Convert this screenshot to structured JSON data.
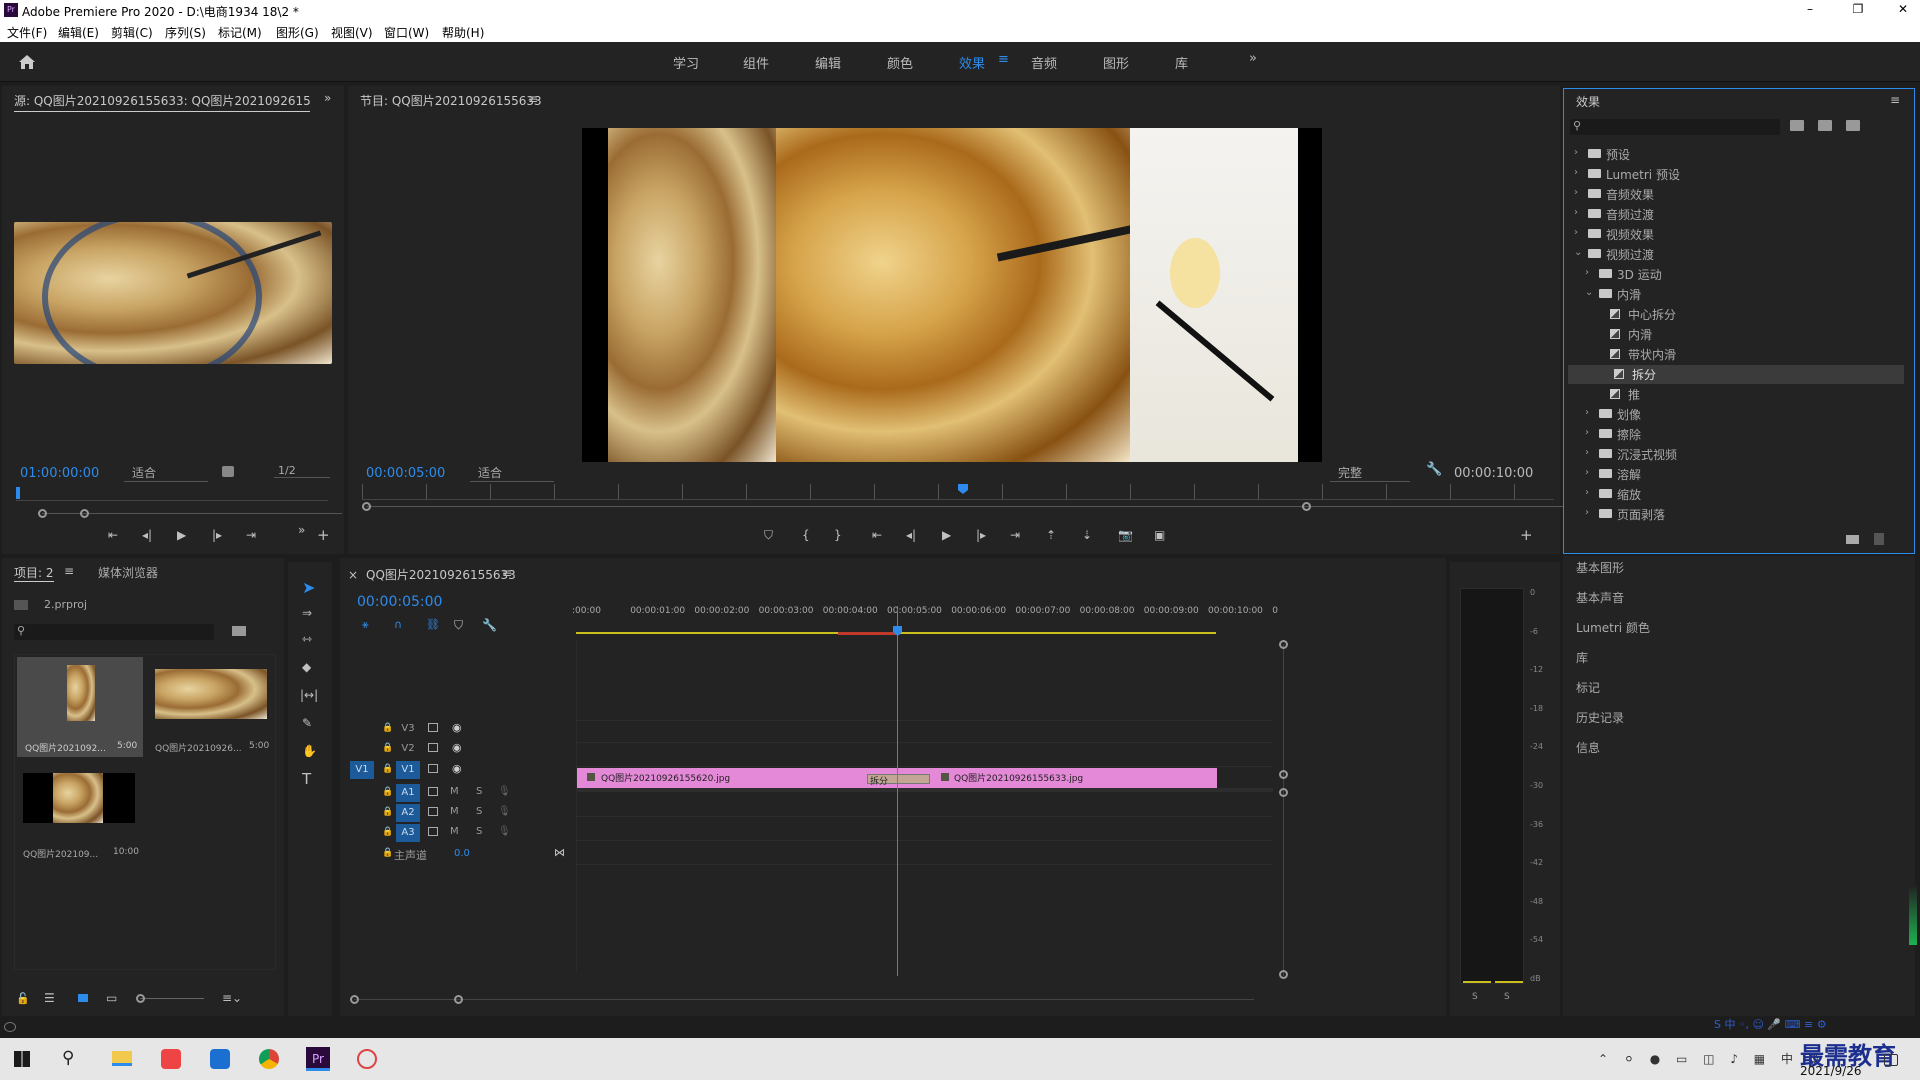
{
  "titlebar": {
    "title": "Adobe Premiere Pro 2020 - D:\\电商1934 18\\2 *",
    "min": "–",
    "max": "❐",
    "close": "✕"
  },
  "menus": [
    "文件(F)",
    "编辑(E)",
    "剪辑(C)",
    "序列(S)",
    "标记(M)",
    "图形(G)",
    "视图(V)",
    "窗口(W)",
    "帮助(H)"
  ],
  "workspaces": [
    "学习",
    "组件",
    "编辑",
    "颜色",
    "效果",
    "音频",
    "图形",
    "库"
  ],
  "workspace_active": "效果",
  "source": {
    "tab": "源: QQ图片20210926155633: QQ图片20210926155633.",
    "timecode": "01:00:00:00",
    "fit": "适合",
    "ratio": "1/2"
  },
  "program": {
    "tab": "节目: QQ图片20210926155633",
    "timecode": "00:00:05:00",
    "fit": "适合",
    "quality": "完整",
    "duration": "00:00:10:00"
  },
  "effects": {
    "title": "效果",
    "items": [
      {
        "label": "预设",
        "level": 0,
        "type": "folder-star",
        "state": "closed"
      },
      {
        "label": "Lumetri 预设",
        "level": 0,
        "type": "folder-star",
        "state": "closed"
      },
      {
        "label": "音频效果",
        "level": 0,
        "type": "folder",
        "state": "closed"
      },
      {
        "label": "音频过渡",
        "level": 0,
        "type": "folder",
        "state": "closed"
      },
      {
        "label": "视频效果",
        "level": 0,
        "type": "folder",
        "state": "closed"
      },
      {
        "label": "视频过渡",
        "level": 0,
        "type": "folder",
        "state": "open"
      },
      {
        "label": "3D 运动",
        "level": 1,
        "type": "folder",
        "state": "closed"
      },
      {
        "label": "内滑",
        "level": 1,
        "type": "folder",
        "state": "open"
      },
      {
        "label": "中心拆分",
        "level": 2,
        "type": "fx",
        "state": ""
      },
      {
        "label": "内滑",
        "level": 2,
        "type": "fx",
        "state": ""
      },
      {
        "label": "带状内滑",
        "level": 2,
        "type": "fx",
        "state": ""
      },
      {
        "label": "拆分",
        "level": 2,
        "type": "fx",
        "state": "selected"
      },
      {
        "label": "推",
        "level": 2,
        "type": "fx",
        "state": ""
      },
      {
        "label": "划像",
        "level": 1,
        "type": "folder",
        "state": "closed"
      },
      {
        "label": "擦除",
        "level": 1,
        "type": "folder",
        "state": "closed"
      },
      {
        "label": "沉浸式视频",
        "level": 1,
        "type": "folder",
        "state": "closed"
      },
      {
        "label": "溶解",
        "level": 1,
        "type": "folder",
        "state": "closed"
      },
      {
        "label": "缩放",
        "level": 1,
        "type": "folder",
        "state": "closed"
      },
      {
        "label": "页面剥落",
        "level": 1,
        "type": "folder",
        "state": "closed"
      }
    ]
  },
  "side_panels": [
    "基本图形",
    "基本声音",
    "Lumetri 颜色",
    "库",
    "标记",
    "历史记录",
    "信息"
  ],
  "project": {
    "tab": "项目: 2",
    "tab2": "媒体浏览器",
    "file": "2.prproj",
    "clips": [
      {
        "name": "QQ图片2021092...",
        "dur": "5:00"
      },
      {
        "name": "QQ图片20210926...",
        "dur": "5:00"
      },
      {
        "name": "QQ图片202109...",
        "dur": "10:00"
      }
    ]
  },
  "timeline": {
    "tab": "QQ图片20210926155633",
    "timecode": "00:00:05:00",
    "ruler": [
      ":00:00",
      "00:00:01:00",
      "00:00:02:00",
      "00:00:03:00",
      "00:00:04:00",
      "00:00:05:00",
      "00:00:06:00",
      "00:00:07:00",
      "00:00:08:00",
      "00:00:09:00",
      "00:00:10:00",
      "0"
    ],
    "video_tracks": [
      "V3",
      "V2",
      "V1"
    ],
    "audio_tracks": [
      "A1",
      "A2",
      "A3"
    ],
    "src_patch": "V1",
    "master": "主声道",
    "master_val": "0.0",
    "m": "M",
    "s": "S",
    "clip1": "QQ图片20210926155620.jpg",
    "clip2": "QQ图片20210926155633.jpg",
    "transition": "拆分"
  },
  "meter": {
    "scale": [
      "0",
      "-6",
      "-12",
      "-18",
      "-24",
      "-30",
      "-36",
      "-42",
      "-48",
      "-54",
      "dB"
    ],
    "s1": "S",
    "s2": "S"
  },
  "taskbar": {
    "date": "2021/9/26",
    "watermark": "最需教育"
  }
}
